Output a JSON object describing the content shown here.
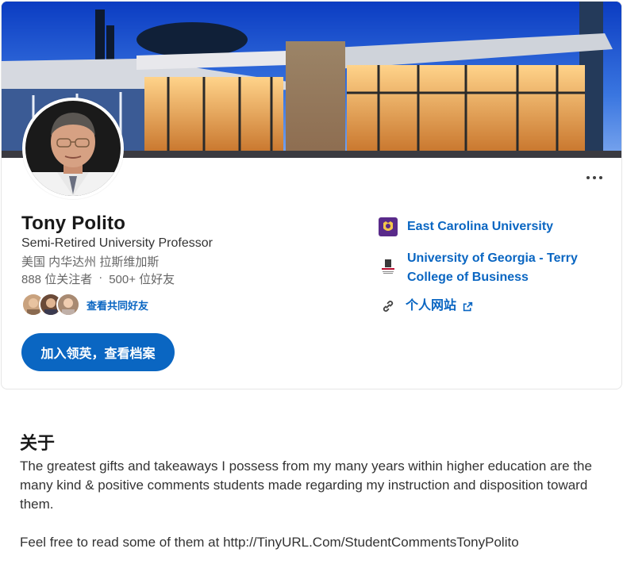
{
  "profile": {
    "name": "Tony Polito",
    "headline": "Semi-Retired University Professor",
    "location": "美国 内华达州 拉斯维加斯",
    "followers": "888 位关注者",
    "separator": "·",
    "connections": "500+ 位好友",
    "mutual_label": "查看共同好友",
    "join_button": "加入领英，查看档案",
    "more_icon": "more-horizontal-icon"
  },
  "experience": {
    "items": [
      {
        "label": "East Carolina University",
        "logo": "ecu-logo",
        "color": "#592a8a"
      },
      {
        "label": "University of Georgia - Terry College of Business",
        "logo": "uga-logo",
        "color": "#ba0c2f"
      }
    ],
    "website_label": "个人网站",
    "website_icon": "link-icon",
    "external_icon": "external-link-icon"
  },
  "about": {
    "title": "关于",
    "paragraph1": "The greatest gifts and takeaways I possess from my many years within higher education are the many kind & positive comments students made regarding my instruction and disposition toward them.",
    "paragraph2": "Feel free to read some of them at http://TinyURL.Com/StudentCommentsTonyPolito"
  },
  "colors": {
    "accent": "#0a66c2",
    "text_primary": "#191919",
    "text_secondary": "#666666"
  }
}
